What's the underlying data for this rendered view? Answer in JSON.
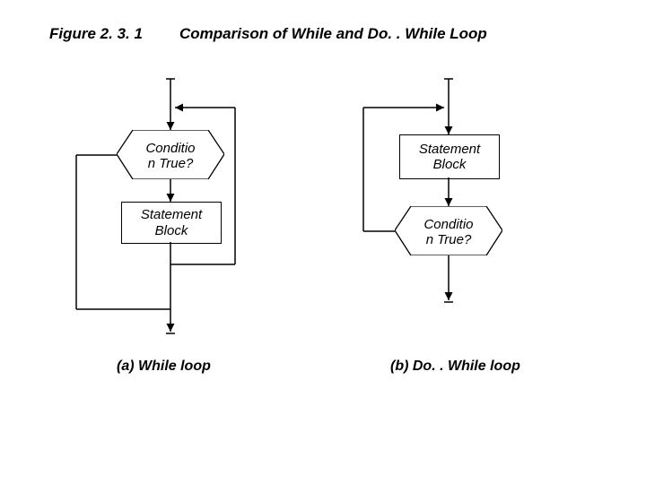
{
  "figure_number": "Figure 2. 3. 1",
  "title": "Comparison of While and Do. . While Loop",
  "while": {
    "condition": "Conditio\nn True?",
    "block": "Statement\nBlock",
    "caption": "(a) While loop"
  },
  "dowhile": {
    "block": "Statement\nBlock",
    "condition": "Conditio\nn True?",
    "caption": "(b) Do. . While loop"
  }
}
